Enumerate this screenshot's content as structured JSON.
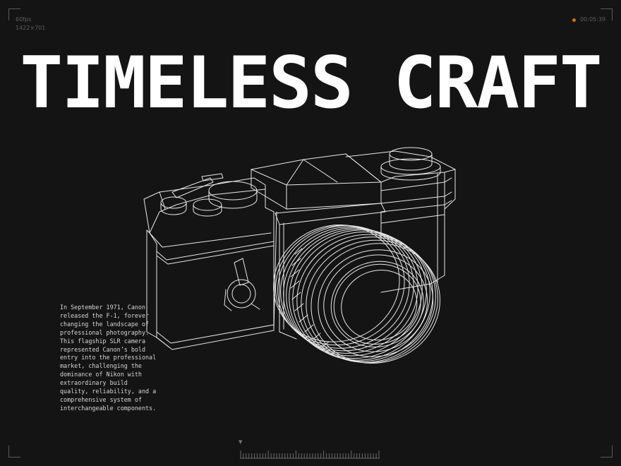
{
  "hud": {
    "fps": "60fps",
    "resolution": "1422×701",
    "timecode": "00:05:39",
    "rec_color": "#c9701e"
  },
  "headline": "TIMELESS CRAFT",
  "description": "In September 1971, Canon released the F-1, forever changing the landscape of professional photography. This flagship SLR camera represented Canon’s bold entry into the professional market, challenging the dominance of Nikon with extraordinary build quality, reliability, and a comprehensive system of interchangeable components.",
  "illustration": {
    "subject": "camera-wireframe-icon",
    "stroke_color": "#e8e8e8"
  },
  "timeline": {
    "marker_glyph": "▼",
    "tick_count": 50
  }
}
